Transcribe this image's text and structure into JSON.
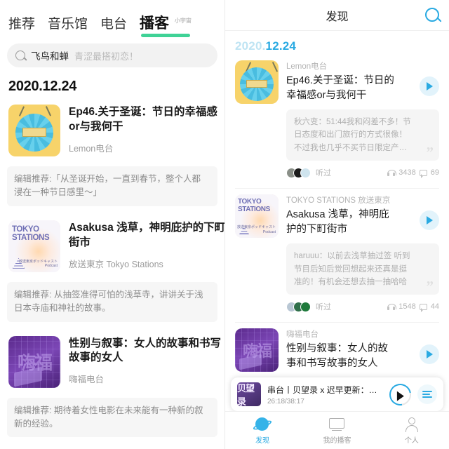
{
  "left_app": {
    "tabs": [
      {
        "label": "推荐",
        "active": false
      },
      {
        "label": "音乐馆",
        "active": false
      },
      {
        "label": "电台",
        "active": false
      },
      {
        "label": "播客",
        "active": true,
        "superscript": "小宇宙"
      }
    ],
    "search": {
      "icon": "search-icon",
      "value": "飞鸟和蝉",
      "hint": "青涩最搭初恋！"
    },
    "date_header": "2020.12.24",
    "episodes": [
      {
        "artwork": "lemon-radio-artwork",
        "title_line1": "Ep46.关于圣诞：节日的幸福感",
        "title_line2": "or与我何干",
        "show": "Lemon电台",
        "recommendation_line1": "编辑推荐:「从圣诞开始，一直到春节，整个人都",
        "recommendation_line2": "浸在一种节日感里～」"
      },
      {
        "artwork": "tokyo-stations-artwork",
        "title_line1": "Asakusa 浅草，神明庇护的下町",
        "title_line2": "街市",
        "show": "放送東京 Tokyo Stations",
        "recommendation_line1": "编辑推荐: 从抽签准得可怕的浅草寺，讲讲关于浅",
        "recommendation_line2": "日本寺庙和神社的故事。"
      },
      {
        "artwork": "hifu-radio-artwork",
        "title_line1": "性别与叙事：女人的故事和书写",
        "title_line2": "故事的女人",
        "show": "嗨福电台",
        "recommendation_line1": "编辑推荐: 期待着女性电影在未来能有一种新的叙",
        "recommendation_line2": "新的经验。"
      }
    ]
  },
  "right_app": {
    "header": {
      "title": "发现",
      "search_icon": "search-icon"
    },
    "date": {
      "year": "2020.",
      "monthday": "12.24"
    },
    "cards": [
      {
        "artwork": "lemon-radio-artwork",
        "show": "Lemon电台",
        "title_line1": "Ep46.关于圣诞：节日的",
        "title_line2": "幸福感or与我何干",
        "play_icon": "play-icon",
        "quote_line1": "秋六变：51:44我和闷差不多！节",
        "quote_line2": "日态度和出门旅行的方式很像！",
        "quote_line3": "不过我也几乎不买节日限定产…",
        "listened_label": "听过",
        "plays": "3438",
        "comments": "69",
        "avatar_colors": [
          "#8a8f88",
          "#1c1c1c",
          "#cfe4ee"
        ]
      },
      {
        "artwork": "tokyo-stations-artwork",
        "show": "TOKYO STATIONS 放送東京",
        "title_line1": "Asakusa 浅草，神明庇",
        "title_line2": "护的下町街市",
        "play_icon": "play-icon",
        "quote_line1": "haruuu：以前去浅草抽过签 听到",
        "quote_line2": "节目后知后觉回想起来还真是挺",
        "quote_line3": "准的！有机会还想去抽一抽哈哈",
        "listened_label": "听过",
        "plays": "1548",
        "comments": "44",
        "avatar_colors": [
          "#b9c7d4",
          "#2f6f4a",
          "#1f7a3c"
        ]
      },
      {
        "artwork": "hifu-radio-artwork",
        "show": "嗨福电台",
        "title_line1": "性别与叙事：女人的故",
        "title_line2": "事和书写故事的女人",
        "play_icon": "play-icon"
      }
    ],
    "player": {
      "artwork_text": "贝望录",
      "title": "串台丨贝望录 x 迟早更新：耳…",
      "time": "26:18/38:17",
      "play_icon": "play-icon",
      "queue_icon": "queue-list-icon"
    },
    "bottom_nav": [
      {
        "label": "发现",
        "icon": "planet-icon",
        "active": true
      },
      {
        "label": "我的播客",
        "icon": "monitor-icon",
        "active": false
      },
      {
        "label": "个人",
        "icon": "person-icon",
        "active": false
      }
    ]
  },
  "colors": {
    "green_accent": "#3fd296",
    "blue_accent": "#2aaae2",
    "muted_text": "#b5b5b5"
  }
}
